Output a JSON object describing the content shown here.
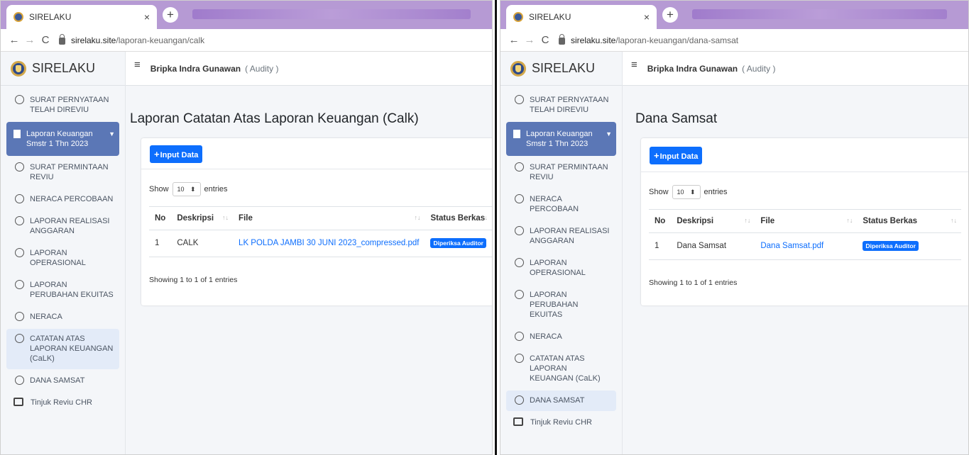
{
  "left": {
    "browser": {
      "tab_title": "SIRELAKU",
      "tab_close": "×",
      "new_tab": "+",
      "url_host": "sirelaku.site",
      "url_path": "/laporan-keuangan/calk"
    },
    "brand": "SIRELAKU",
    "header": {
      "user": "Bripka Indra Gunawan",
      "role": "( Audity )"
    },
    "sidebar": [
      {
        "label": "SURAT PERNYATAAN TELAH DIREVIU",
        "state": "normal"
      },
      {
        "label": "Laporan Keuangan Smstr 1 Thn 2023",
        "state": "active"
      },
      {
        "label": "SURAT PERMINTAAN REVIU",
        "state": "normal"
      },
      {
        "label": "NERACA PERCOBAAN",
        "state": "normal"
      },
      {
        "label": "LAPORAN REALISASI ANGGARAN",
        "state": "normal"
      },
      {
        "label": "LAPORAN OPERASIONAL",
        "state": "normal"
      },
      {
        "label": "LAPORAN PERUBAHAN EKUITAS",
        "state": "normal"
      },
      {
        "label": "NERACA",
        "state": "normal"
      },
      {
        "label": "CATATAN ATAS LAPORAN KEUANGAN (CaLK)",
        "state": "selected"
      },
      {
        "label": "DANA SAMSAT",
        "state": "normal"
      }
    ],
    "sidebar_bottom": "Tinjuk Reviu CHR",
    "page_title": "Laporan Catatan Atas Laporan Keuangan (Calk)",
    "input_button": "Input Data",
    "show_label": "Show",
    "entries_select": "10",
    "entries_label": "entries",
    "table": {
      "headers": [
        "No",
        "Deskripsi",
        "File",
        "Status Berkas"
      ],
      "rows": [
        {
          "no": "1",
          "deskripsi": "CALK",
          "file": "LK POLDA JAMBI 30 JUNI 2023_compressed.pdf",
          "status": "Diperiksa Auditor"
        }
      ]
    },
    "info": "Showing 1 to 1 of 1 entries"
  },
  "right": {
    "browser": {
      "tab_title": "SIRELAKU",
      "tab_close": "×",
      "new_tab": "+",
      "url_host": "sirelaku.site",
      "url_path": "/laporan-keuangan/dana-samsat"
    },
    "brand": "SIRELAKU",
    "header": {
      "user": "Bripka Indra Gunawan",
      "role": "( Audity )"
    },
    "sidebar": [
      {
        "label": "SURAT PERNYATAAN TELAH DIREVIU",
        "state": "normal"
      },
      {
        "label": "Laporan Keuangan Smstr 1 Thn 2023",
        "state": "active"
      },
      {
        "label": "SURAT PERMINTAAN REVIU",
        "state": "normal"
      },
      {
        "label": "NERACA PERCOBAAN",
        "state": "normal"
      },
      {
        "label": "LAPORAN REALISASI ANGGARAN",
        "state": "normal"
      },
      {
        "label": "LAPORAN OPERASIONAL",
        "state": "normal"
      },
      {
        "label": "LAPORAN PERUBAHAN EKUITAS",
        "state": "normal"
      },
      {
        "label": "NERACA",
        "state": "normal"
      },
      {
        "label": "CATATAN ATAS LAPORAN KEUANGAN (CaLK)",
        "state": "normal"
      },
      {
        "label": "DANA SAMSAT",
        "state": "selected"
      }
    ],
    "sidebar_bottom": "Tinjuk Reviu CHR",
    "page_title": "Dana Samsat",
    "input_button": "Input Data",
    "show_label": "Show",
    "entries_select": "10",
    "entries_label": "entries",
    "table": {
      "headers": [
        "No",
        "Deskripsi",
        "File",
        "Status Berkas"
      ],
      "rows": [
        {
          "no": "1",
          "deskripsi": "Dana Samsat",
          "file": "Dana Samsat.pdf",
          "status": "Diperiksa Auditor"
        }
      ]
    },
    "info": "Showing 1 to 1 of 1 entries"
  },
  "colors": {
    "primary": "#0d6efd",
    "sidebar_active": "#5b77b6",
    "tabstrip": "#b69ad4"
  }
}
